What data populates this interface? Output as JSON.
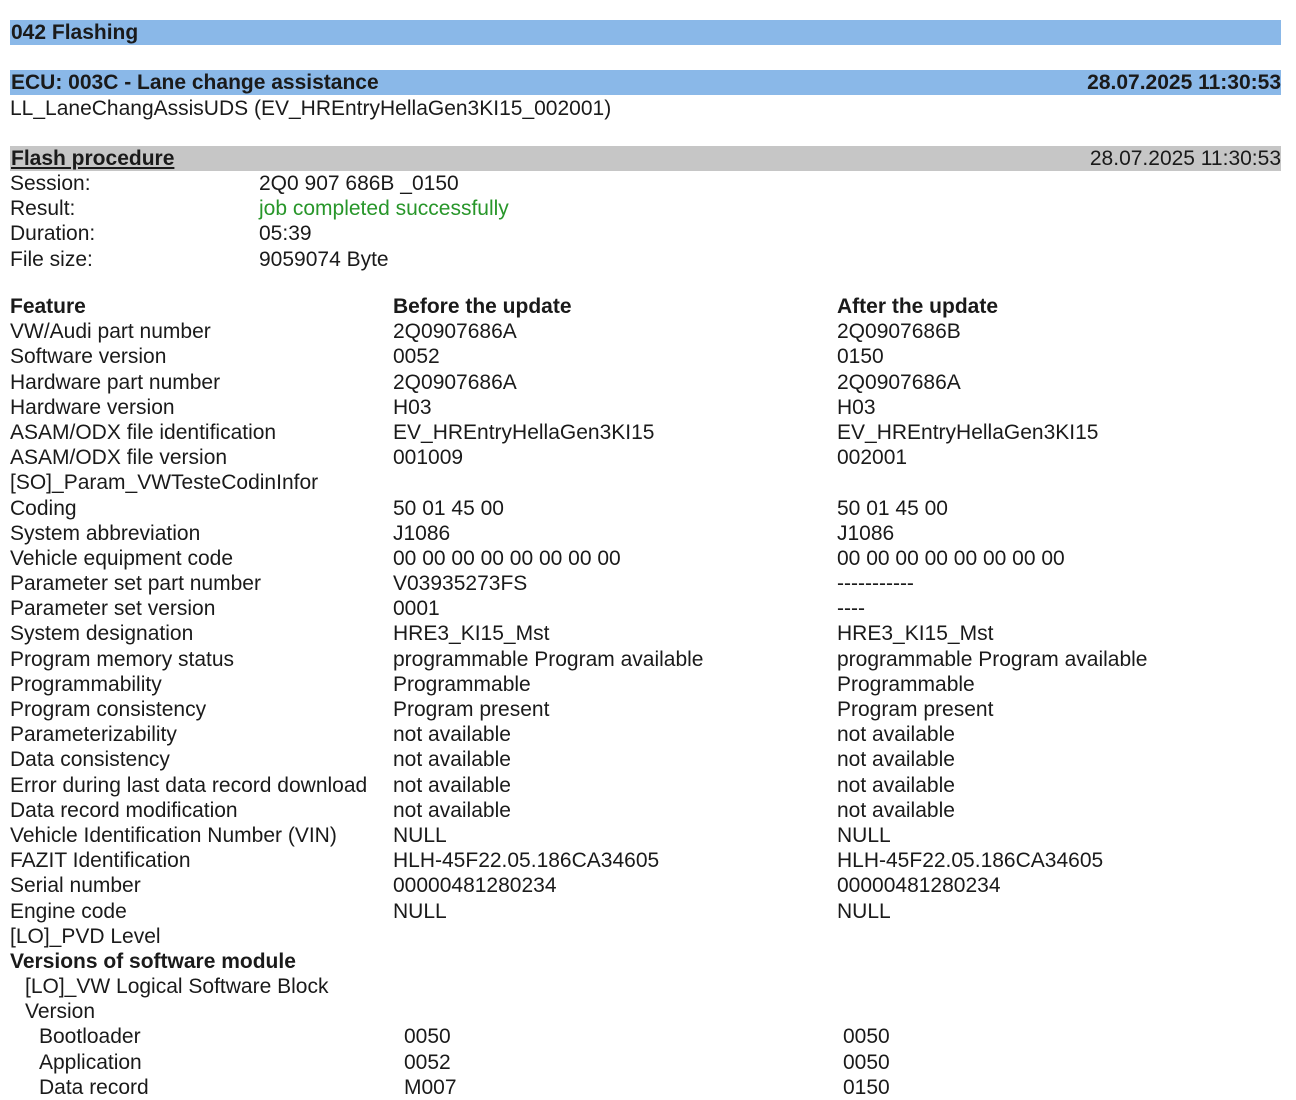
{
  "section_title": "042 Flashing",
  "ecu": {
    "title": "ECU: 003C - Lane change assistance",
    "timestamp": "28.07.2025 11:30:53",
    "subtitle": "LL_LaneChangAssisUDS (EV_HREntryHellaGen3KI15_002001)"
  },
  "flash": {
    "title": "Flash procedure",
    "timestamp": "28.07.2025 11:30:53",
    "fields": [
      {
        "label": "Session:",
        "value": "2Q0 907 686B _0150"
      },
      {
        "label": "Result:",
        "value": "job completed successfully"
      },
      {
        "label": "Duration:",
        "value": "05:39"
      },
      {
        "label": "File size:",
        "value": "9059074 Byte"
      }
    ],
    "result_color": "#28962a"
  },
  "table": {
    "headers": [
      "Feature",
      "Before the update",
      "After the update"
    ],
    "rows": [
      {
        "feature": "VW/Audi part number",
        "before": "2Q0907686A",
        "after": "2Q0907686B"
      },
      {
        "feature": "Software version",
        "before": "0052",
        "after": "0150"
      },
      {
        "feature": "Hardware part number",
        "before": "2Q0907686A",
        "after": "2Q0907686A"
      },
      {
        "feature": "Hardware version",
        "before": "H03",
        "after": "H03"
      },
      {
        "feature": "ASAM/ODX file identification",
        "before": "EV_HREntryHellaGen3KI15",
        "after": "EV_HREntryHellaGen3KI15"
      },
      {
        "feature": "ASAM/ODX file version",
        "before": "001009",
        "after": "002001"
      },
      {
        "feature": "[SO]_Param_VWTesteCodinInfor",
        "before": "",
        "after": ""
      },
      {
        "feature": "Coding",
        "before": "50 01 45 00",
        "after": "50 01 45 00"
      },
      {
        "feature": "System abbreviation",
        "before": "J1086",
        "after": "J1086"
      },
      {
        "feature": "Vehicle equipment code",
        "before": "00 00 00 00 00 00 00 00",
        "after": "00 00 00 00 00 00 00 00"
      },
      {
        "feature": "Parameter set part number",
        "before": "V03935273FS",
        "after": "-----------"
      },
      {
        "feature": "Parameter set version",
        "before": "0001",
        "after": "----"
      },
      {
        "feature": "System designation",
        "before": "HRE3_KI15_Mst",
        "after": "HRE3_KI15_Mst"
      },
      {
        "feature": "Program memory status",
        "before": "programmable Program available",
        "after": "programmable Program available"
      },
      {
        "feature": "Programmability",
        "before": "Programmable",
        "after": "Programmable"
      },
      {
        "feature": "Program consistency",
        "before": "Program present",
        "after": "Program present"
      },
      {
        "feature": "Parameterizability",
        "before": "not available",
        "after": "not available"
      },
      {
        "feature": "Data consistency",
        "before": "not available",
        "after": "not available"
      },
      {
        "feature": "Error during last data record download",
        "before": "not available",
        "after": "not available"
      },
      {
        "feature": "Data record modification",
        "before": "not available",
        "after": "not available"
      },
      {
        "feature": "Vehicle Identification Number (VIN)",
        "before": "NULL",
        "after": "NULL"
      },
      {
        "feature": "FAZIT Identification",
        "before": "HLH-45F22.05.186CA34605",
        "after": "HLH-45F22.05.186CA34605"
      },
      {
        "feature": "Serial number",
        "before": "00000481280234",
        "after": "00000481280234"
      },
      {
        "feature": "Engine code",
        "before": "NULL",
        "after": "NULL"
      },
      {
        "feature": "[LO]_PVD Level",
        "before": "",
        "after": ""
      }
    ],
    "software_modules": {
      "title": "Versions of software module",
      "block": "[LO]_VW Logical Software Block",
      "version_label": "Version",
      "items": [
        {
          "feature": "Bootloader",
          "before": "0050",
          "after": "0050"
        },
        {
          "feature": "Application",
          "before": "0052",
          "after": "0050"
        },
        {
          "feature": "Data record",
          "before": "M007",
          "after": "0150"
        }
      ]
    }
  }
}
